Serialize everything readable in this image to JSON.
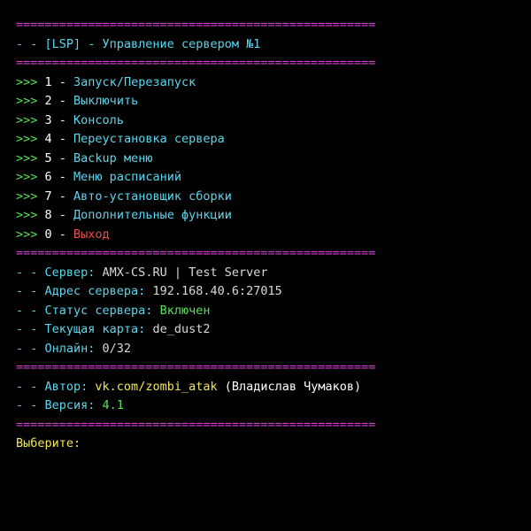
{
  "colors": {
    "background": "#000000",
    "separator": "#d93fd9",
    "cyan": "#5ad6ee",
    "green": "#56e356",
    "yellow": "#f2e55a",
    "red": "#f24a4a",
    "white": "#ffffff",
    "gray": "#d9d9d9"
  },
  "separator": "==================================================",
  "header": {
    "prefix": "- - ",
    "title": "[LSP] - Управление сервером №1"
  },
  "menu": {
    "arrow": ">>> ",
    "items": [
      {
        "key": "1",
        "dash": " - ",
        "label": "Запуск/Перезапуск"
      },
      {
        "key": "2",
        "dash": " - ",
        "label": "Выключить"
      },
      {
        "key": "3",
        "dash": " - ",
        "label": "Консоль"
      },
      {
        "key": "4",
        "dash": " - ",
        "label": "Переустановка сервера"
      },
      {
        "key": "5",
        "dash": " - ",
        "label": "Backup меню"
      },
      {
        "key": "6",
        "dash": " - ",
        "label": "Меню расписаний"
      },
      {
        "key": "7",
        "dash": " - ",
        "label": "Авто-установщик сборки"
      },
      {
        "key": "8",
        "dash": " - ",
        "label": "Дополнительные функции"
      },
      {
        "key": "0",
        "dash": " - ",
        "label": "Выход"
      }
    ]
  },
  "server_info": {
    "prefix": "- - ",
    "server_label": "Сервер: ",
    "server_value": "AMX-CS.RU | Test Server",
    "address_label": "Адрес сервера: ",
    "address_value": "192.168.40.6:27015",
    "status_label": "Статус сервера: ",
    "status_value": "Включен",
    "map_label": "Текущая карта: ",
    "map_value": "de_dust2",
    "online_label": "Онлайн: ",
    "online_value": "0/32"
  },
  "about": {
    "prefix": "- - ",
    "author_label": "Автор: ",
    "author_link": "vk.com/zombi_atak",
    "author_name": " (Владислав Чумаков)",
    "version_label": "Версия: ",
    "version_value": "4.1"
  },
  "prompt": {
    "text": "Выберите:"
  }
}
